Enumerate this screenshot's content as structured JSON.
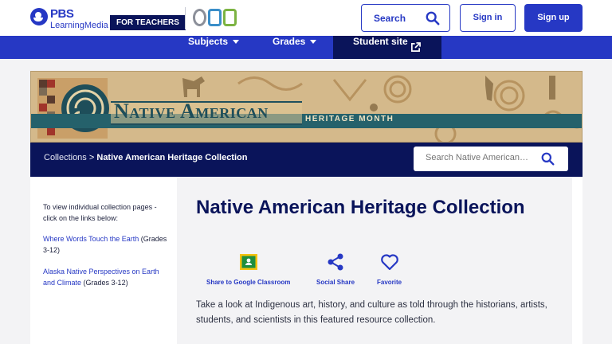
{
  "header": {
    "brand_word": "PBS",
    "brand_sub": "LearningMedia",
    "badge": "FOR TEACHERS",
    "partner": "OPB",
    "search_label": "Search",
    "signin_label": "Sign in",
    "signup_label": "Sign up"
  },
  "nav": {
    "subjects": "Subjects",
    "grades": "Grades",
    "student_site": "Student site"
  },
  "banner": {
    "title": "Native American",
    "subtitle": "HERITAGE MONTH"
  },
  "breadcrumb": {
    "parent": "Collections",
    "separator": ">",
    "current": "Native American Heritage Collection"
  },
  "collection_search": {
    "placeholder": "Search Native American Heritage Collection"
  },
  "sidebar": {
    "intro": "To view individual collection pages - click on the links below:",
    "items": [
      {
        "link": "Where Words Touch the Earth",
        "grades": "(Grades 3-12)"
      },
      {
        "link": "Alaska Native Perspectives on Earth and Climate",
        "grades": "(Grades 3-12)"
      }
    ]
  },
  "main": {
    "title": "Native American Heritage Collection",
    "actions": [
      {
        "label": "Share to Google Classroom",
        "icon": "google-classroom-icon"
      },
      {
        "label": "Social Share",
        "icon": "share-icon"
      },
      {
        "label": "Favorite",
        "icon": "heart-icon"
      }
    ],
    "description": "Take a look at Indigenous art, history, and culture as told through the historians, artists, students, and scientists in this featured resource collection."
  },
  "colors": {
    "brand_blue": "#2638c4",
    "navy": "#0a145a",
    "banner_teal": "#25616b",
    "banner_sand": "#d2b88a"
  }
}
